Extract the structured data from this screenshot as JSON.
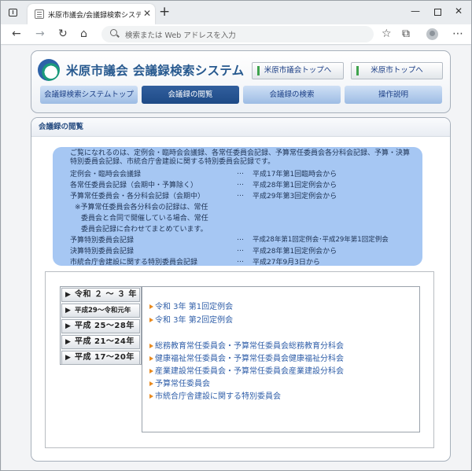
{
  "browser": {
    "tab_title": "米原市議会/会議録検索システム",
    "tab_close": "✕",
    "new_tab": "+",
    "address_placeholder": "検索または Web アドレスを入力",
    "min_glyph": "—",
    "close_glyph": "✕",
    "back_glyph": "←",
    "forward_glyph": "→",
    "reload_glyph": "↻",
    "home_glyph": "⌂",
    "star_glyph": "☆",
    "collections_glyph": "⧉",
    "more_glyph": "⋯"
  },
  "header": {
    "title": "米原市議会 会議録検索システム",
    "links": [
      {
        "label": "米原市議会トップへ"
      },
      {
        "label": "米原市トップへ"
      }
    ]
  },
  "nav": {
    "active_index": 1,
    "tabs": [
      {
        "label": "会議録検索システムトップ"
      },
      {
        "label": "会議録の閲覧"
      },
      {
        "label": "会議録の検索"
      },
      {
        "label": "操作説明"
      }
    ]
  },
  "section": {
    "title": "会議録の閲覧"
  },
  "info": {
    "intro": "ご覧になれるのは、定例会・臨時会会議録、各常任委員会記録、予算常任委員会各分科会記録、予算・決算特別委員会記録、市統合庁舎建設に関する特別委員会記録です。",
    "rows": [
      {
        "name": "定例会・臨時会会議録",
        "sep": "…",
        "from": "平成17年第1回臨時会から"
      },
      {
        "name": "各常任委員会記録（会期中・予算除く）",
        "sep": "…",
        "from": "平成28年第1回定例会から"
      },
      {
        "name": "予算常任委員会・各分科会記録（会期中）",
        "sep": "…",
        "from": "平成29年第3回定例会から"
      }
    ],
    "note_lines": [
      "※予算常任委員会各分科会の記録は、常任",
      "委員会と合同で開催している場合、常任",
      "委員会記録に合わせてまとめています。"
    ],
    "rows2": [
      {
        "name": "予算特別委員会記録",
        "sep": "…",
        "from": "平成28年第1回定例会･平成29年第1回定例会"
      },
      {
        "name": "決算特別委員会記録",
        "sep": "…",
        "from": "平成28年第1回定例会から"
      },
      {
        "name": "市統合庁舎建設に関する特別委員会記録",
        "sep": "…",
        "from": "平成27年9月3日から"
      }
    ]
  },
  "archive": {
    "arrow_glyph": "▶",
    "years": [
      {
        "label": "令和 ２ ～ ３ 年",
        "selected": true
      },
      {
        "label": "平成29～令和元年",
        "selected": false
      },
      {
        "label": "平成 25～28年",
        "selected": false
      },
      {
        "label": "平成 21～24年",
        "selected": false
      },
      {
        "label": "平成 17～20年",
        "selected": false
      }
    ],
    "sessions": [
      {
        "label": "令和 3年 第1回定例会"
      },
      {
        "label": "令和 3年 第2回定例会"
      }
    ],
    "committees": [
      {
        "label": "総務教育常任委員会・予算常任委員会総務教育分科会"
      },
      {
        "label": "健康福祉常任委員会・予算常任委員会健康福祉分科会"
      },
      {
        "label": "産業建設常任委員会・予算常任委員会産業建設分科会"
      },
      {
        "label": "予算常任委員会"
      },
      {
        "label": "市統合庁舎建設に関する特別委員会"
      }
    ]
  },
  "colors": {
    "accent": "#27598f",
    "active_tab": "#1e4a86",
    "inactive_tab": "#a9c6ea",
    "info_bg": "#a6c7f3",
    "link": "#2f5ea8",
    "bullet": "#e88a1f"
  }
}
